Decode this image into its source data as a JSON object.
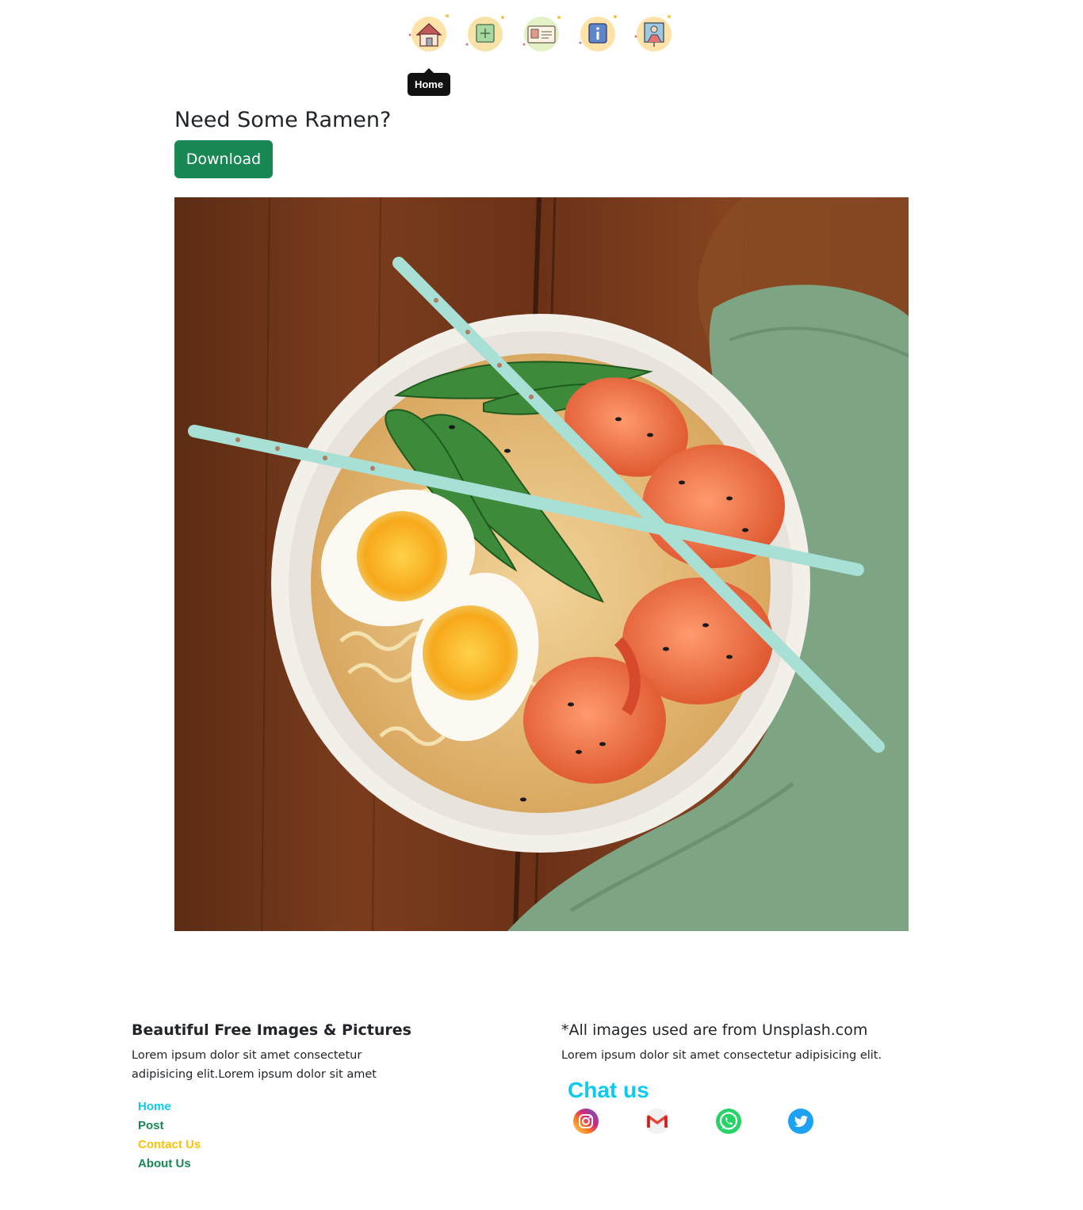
{
  "nav": {
    "items": [
      {
        "id": "home",
        "icon": "home-icon",
        "blob": "#ffe2a8"
      },
      {
        "id": "post",
        "icon": "add-post-icon",
        "blob": "#f7e3a8"
      },
      {
        "id": "contact",
        "icon": "contact-card-icon",
        "blob": "#e4f0c5"
      },
      {
        "id": "about",
        "icon": "info-icon",
        "blob": "#ffe2a8"
      },
      {
        "id": "user",
        "icon": "profile-icon",
        "blob": "#ffe2a8"
      }
    ],
    "tooltip": "Home"
  },
  "header": {
    "title": "Need Some Ramen?",
    "download_label": "Download"
  },
  "hero": {
    "image": "ramen-bowl-photo"
  },
  "footer": {
    "title": "Beautiful Free Images & Pictures",
    "text": "Lorem ipsum dolor sit amet consectetur adipisicing elit.Lorem ipsum dolor sit amet",
    "links": [
      {
        "label": "Home",
        "color": "#0dcaf0"
      },
      {
        "label": "Post",
        "color": "#198754"
      },
      {
        "label": "Contact Us",
        "color": "#ffc107"
      },
      {
        "label": "About Us",
        "color": "#198754"
      }
    ],
    "credit_title": "*All images used are from Unsplash.com",
    "credit_text": "Lorem ipsum dolor sit amet consectetur adipisicing elit.",
    "chat_title": "Chat us",
    "social": [
      {
        "name": "instagram",
        "icon": "instagram-icon"
      },
      {
        "name": "gmail",
        "icon": "gmail-icon"
      },
      {
        "name": "whatsapp",
        "icon": "whatsapp-icon"
      },
      {
        "name": "twitter",
        "icon": "twitter-icon"
      }
    ]
  },
  "colors": {
    "primary_green": "#198754",
    "info_cyan": "#0dcaf0",
    "warning_yellow": "#ffc107"
  }
}
